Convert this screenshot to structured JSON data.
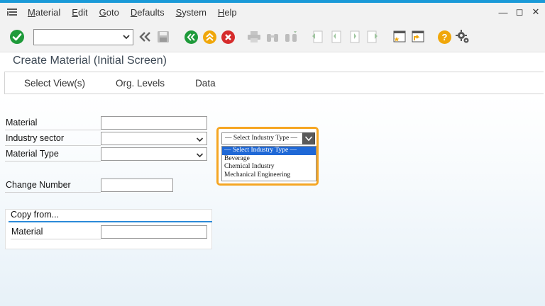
{
  "menu": {
    "items": [
      {
        "first": "M",
        "rest": "aterial"
      },
      {
        "first": "E",
        "rest": "dit"
      },
      {
        "first": "G",
        "rest": "oto"
      },
      {
        "first": "D",
        "rest": "efaults"
      },
      {
        "first": "S",
        "rest": "ystem"
      },
      {
        "first": "H",
        "rest": "elp"
      }
    ]
  },
  "window_controls": {
    "minimize": "—",
    "maximize": "◻",
    "close": "✕"
  },
  "toolbar": {
    "command_field_value": "",
    "icons": [
      "enter-icon",
      "back-double-icon",
      "save-icon",
      "back-icon",
      "exit-icon",
      "cancel-icon",
      "print-icon",
      "find-icon",
      "find-next-icon",
      "first-page-icon",
      "previous-page-icon",
      "next-page-icon",
      "last-page-icon",
      "create-session-icon",
      "shortcut-icon",
      "help-icon",
      "settings-icon"
    ]
  },
  "colors": {
    "accent": "#1a9ad8",
    "enter_green": "#1e9a3a",
    "cancel_red": "#d62b2b",
    "exit_orange": "#f0a70a",
    "highlight": "#f5a623",
    "selected": "#1f68d6"
  },
  "page": {
    "title": "Create Material (Initial Screen)"
  },
  "tabs": [
    "Select View(s)",
    "Org. Levels",
    "Data"
  ],
  "form": {
    "material_label": "Material",
    "material_value": "",
    "industry_sector_label": "Industry sector",
    "industry_sector_value": "",
    "material_type_label": "Material Type",
    "material_type_value": "",
    "change_number_label": "Change Number",
    "change_number_value": ""
  },
  "copy_from": {
    "title": "Copy from...",
    "material_label": "Material",
    "material_value": ""
  },
  "industry_dropdown": {
    "selected": "— Select Industry Type —",
    "options": [
      "— Select Industry Type —",
      "Beverage",
      "Chemical Industry",
      "Mechanical Engineering"
    ]
  }
}
